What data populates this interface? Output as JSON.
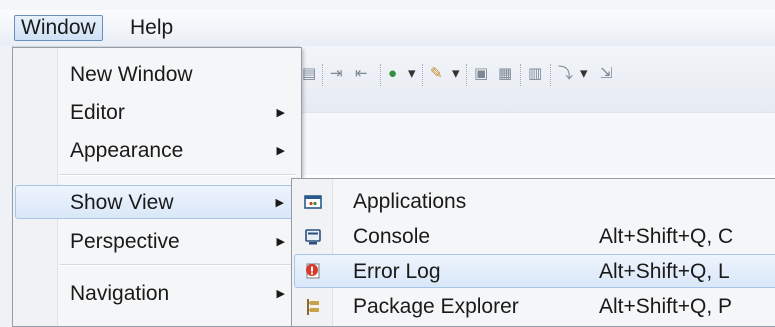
{
  "menubar": {
    "items": [
      {
        "label": "Window",
        "active": true
      },
      {
        "label": "Help",
        "active": false
      }
    ]
  },
  "window_menu": {
    "items": [
      {
        "label": "New Window",
        "has_submenu": false
      },
      {
        "label": "Editor",
        "has_submenu": true
      },
      {
        "label": "Appearance",
        "has_submenu": true
      },
      {
        "label": "Show View",
        "has_submenu": true,
        "highlighted": true
      },
      {
        "label": "Perspective",
        "has_submenu": true
      },
      {
        "label": "Navigation",
        "has_submenu": true
      }
    ]
  },
  "show_view_menu": {
    "items": [
      {
        "label": "Applications",
        "shortcut": "",
        "icon": "applications-icon"
      },
      {
        "label": "Console",
        "shortcut": "Alt+Shift+Q, C",
        "icon": "console-icon"
      },
      {
        "label": "Error Log",
        "shortcut": "Alt+Shift+Q, L",
        "icon": "error-log-icon",
        "highlighted": true
      },
      {
        "label": "Package Explorer",
        "shortcut": "Alt+Shift+Q, P",
        "icon": "package-explorer-icon"
      }
    ]
  },
  "colors": {
    "highlight_border": "#a8c4e6",
    "menu_background": "#f5f6f7",
    "error_red": "#d83a2a"
  }
}
